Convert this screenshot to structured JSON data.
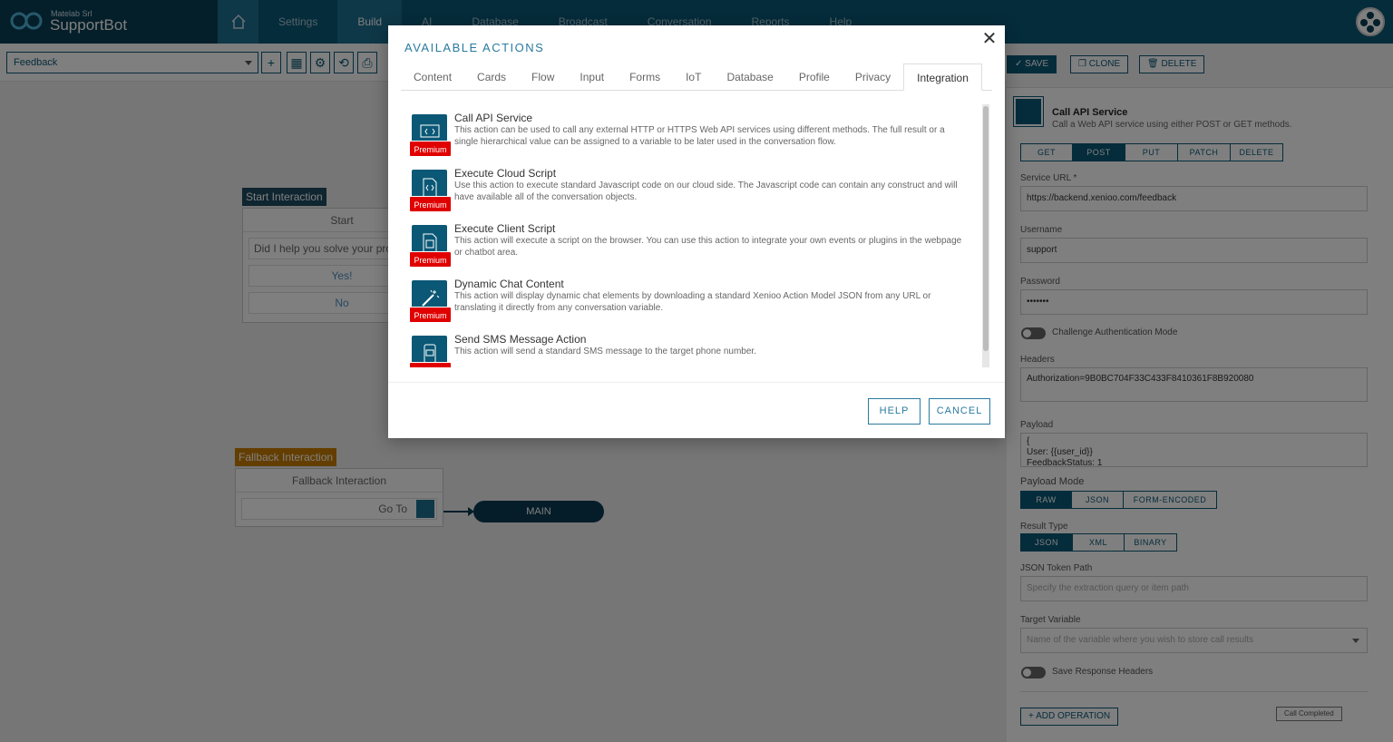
{
  "topbar": {
    "company": "Matelab Srl",
    "app_name": "SupportBot",
    "nav": [
      "Settings",
      "Build",
      "AI",
      "Database",
      "Broadcast",
      "Conversation",
      "Reports",
      "Help"
    ],
    "active_nav": "Build"
  },
  "toolbar": {
    "flow_select": "Feedback",
    "add_label": "+"
  },
  "canvas": {
    "start_tag": "Start Interaction",
    "start_title": "Start",
    "start_question": "Did I help you solve your problem?",
    "start_answers": [
      "Yes!",
      "No"
    ],
    "fallback_tag": "Fallback Interaction",
    "fallback_title": "Fallback Interaction",
    "fallback_row": "Go To",
    "target_pill": "MAIN"
  },
  "right_panel": {
    "save": "SAVE",
    "clone": "CLONE",
    "delete": "DELETE",
    "action_title": "Call API Service",
    "action_desc": "Call a Web API service using either POST or GET methods.",
    "methods": [
      "GET",
      "POST",
      "PUT",
      "PATCH",
      "DELETE"
    ],
    "selected_method": "POST",
    "service_url_label": "Service URL *",
    "service_url": "https://backend.xenioo.com/feedback",
    "username_label": "Username",
    "username": "support",
    "password_label": "Password",
    "password": "•••••••",
    "challenge_label": "Challenge Authentication Mode",
    "headers_label": "Headers",
    "headers": "Authorization=9B0BC704F33C433F8410361F8B920080",
    "payload_label": "Payload",
    "payload_lines": [
      "{",
      "User: {{user_id}}",
      "FeedbackStatus: 1"
    ],
    "payload_mode_label": "Payload Mode",
    "payload_modes": [
      "RAW",
      "JSON",
      "FORM-ENCODED"
    ],
    "result_type_label": "Result Type",
    "result_types": [
      "JSON",
      "XML",
      "BINARY"
    ],
    "token_path_label": "JSON Token Path",
    "token_path_placeholder": "Specify the extraction query or item path",
    "target_var_label": "Target Variable",
    "target_var_placeholder": "Name of the variable where you wish to store call results",
    "save_headers_label": "Save Response Headers",
    "add_operation": "+ ADD OPERATION",
    "call_completed": "Call Completed"
  },
  "modal": {
    "title": "AVAILABLE ACTIONS",
    "tabs": [
      "Content",
      "Cards",
      "Flow",
      "Input",
      "Forms",
      "IoT",
      "Database",
      "Profile",
      "Privacy",
      "Integration"
    ],
    "active_tab": "Integration",
    "premium_label": "Premium",
    "actions": [
      {
        "name": "Call API Service",
        "desc": "This action can be used to call any external HTTP or HTTPS Web API services using different methods. The full result or a single hierarchical value can be assigned to a variable to be later used in the conversation flow.",
        "icon": "api-icon"
      },
      {
        "name": "Execute Cloud Script",
        "desc": "Use this action to execute standard Javascript code on our cloud side. The Javascript code can contain any construct and will have available all of the conversation objects.",
        "icon": "cloud-script-icon"
      },
      {
        "name": "Execute Client Script",
        "desc": "This action will execute a script on the browser. You can use this action to integrate your own events or plugins in the webpage or chatbot area.",
        "icon": "client-script-icon"
      },
      {
        "name": "Dynamic Chat Content",
        "desc": "This action will display dynamic chat elements by downloading a standard Xenioo Action Model JSON from any URL or translating it directly from any conversation variable.",
        "icon": "magic-wand-icon"
      },
      {
        "name": "Send SMS Message Action",
        "desc": "This action will send a standard SMS message to the target phone number.",
        "icon": "sms-icon"
      }
    ],
    "help": "HELP",
    "cancel": "CANCEL",
    "close": "✕"
  },
  "colors": {
    "brand": "#0b5876",
    "brand_dark": "#083e55",
    "premium": "#e00000",
    "start_tag": "#1e4a60",
    "fallback_tag": "#c77c00"
  }
}
